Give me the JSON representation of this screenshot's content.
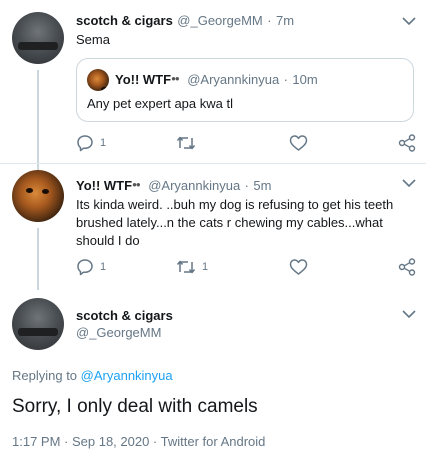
{
  "tweets": [
    {
      "name": "scotch & cigars",
      "handle": "@_GeorgeMM",
      "time": "7m",
      "text": "Sema",
      "quote": {
        "name": "Yo!! WTF",
        "handle": "@Aryannkinyua",
        "time": "10m",
        "text": "Any pet expert apa kwa tl"
      },
      "actions": {
        "reply_count": "1",
        "retweet_count": "",
        "like_count": ""
      }
    },
    {
      "name": "Yo!! WTF",
      "handle": "@Aryannkinyua",
      "time": "5m",
      "text_line1": "Its kinda weird. ..buh my dog is refusing to get his teeth",
      "text_line2": "brushed lately...n the cats r chewing my cables...what",
      "text_line3": "should I do",
      "actions": {
        "reply_count": "1",
        "retweet_count": "1",
        "like_count": ""
      }
    }
  ],
  "main_tweet": {
    "name": "scotch & cigars",
    "handle": "@_GeorgeMM",
    "replying_prefix": "Replying to ",
    "replying_to": "@Aryannkinyua",
    "text": "Sorry, I only deal with camels",
    "meta": "1:17 PM · Sep 18, 2020 · Twitter for Android"
  },
  "emoji_eyes": "👀",
  "colors": {
    "link": "#1da1f2",
    "secondary": "#657786",
    "border": "#e1e8ed"
  },
  "icons": [
    "reply-icon",
    "retweet-icon",
    "like-icon",
    "share-icon",
    "chevron-down-icon"
  ]
}
